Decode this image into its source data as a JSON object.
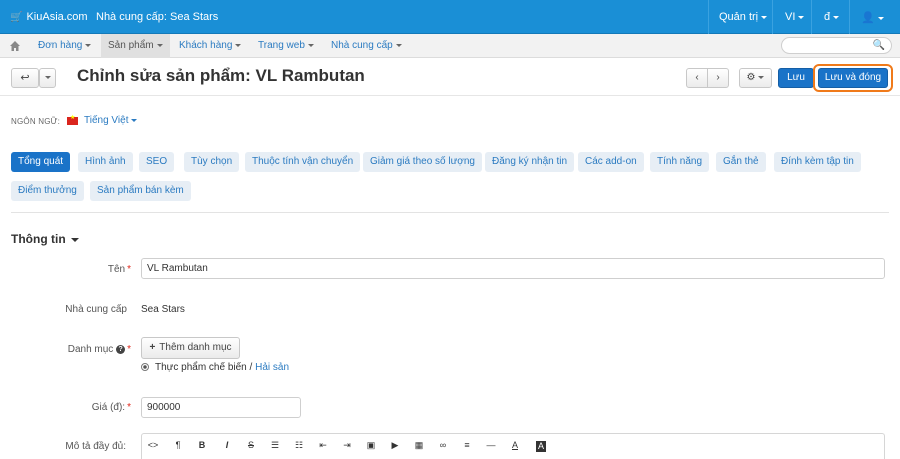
{
  "topbar": {
    "logo": "KiuAsia.com",
    "vendor": "Nhà cung cấp: Sea Stars",
    "admin": "Quản trị",
    "lang": "VI",
    "currency": "đ"
  },
  "nav": {
    "items": [
      "Đơn hàng",
      "Sản phẩm",
      "Khách hàng",
      "Trang web",
      "Nhà cung cấp"
    ],
    "search_placeholder": ""
  },
  "actions": {
    "title": "Chỉnh sửa sản phẩm: VL Rambutan",
    "save": "Lưu",
    "save_close": "Lưu và đóng"
  },
  "language": {
    "label": "NGÔN NGỮ:",
    "value": "Tiếng Việt"
  },
  "tabs": [
    "Tổng quát",
    "Hình ảnh",
    "SEO",
    "Tùy chọn",
    "Thuộc tính vận chuyển",
    "Giảm giá theo số lượng",
    "Đăng ký nhận tin",
    "Các add-on",
    "Tính năng",
    "Gắn thẻ",
    "Đính kèm tập tin",
    "Điểm thưởng",
    "Sản phẩm bán kèm"
  ],
  "section": "Thông tin",
  "form": {
    "name_label": "Tên",
    "name_value": "VL Rambutan",
    "vendor_label": "Nhà cung cấp",
    "vendor_value": "Sea Stars",
    "category_label": "Danh mục",
    "add_category": "Thêm danh mục",
    "category_path_1": "Thực phẩm chế biến",
    "category_sep": " / ",
    "category_path_2": "Hải sản",
    "price_label": "Giá (đ):",
    "price_value": "900000",
    "desc_label": "Mô tả đầy đủ:"
  }
}
